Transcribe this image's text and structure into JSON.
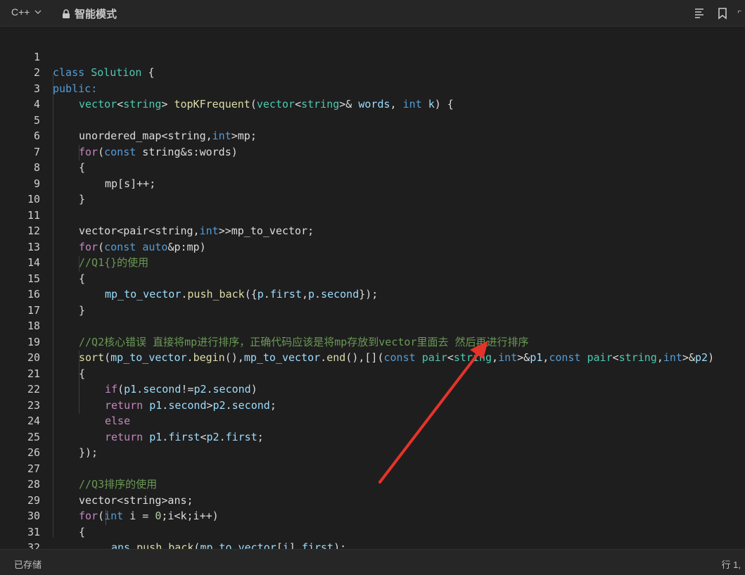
{
  "toolbar": {
    "language": "C++",
    "mode": "智能模式",
    "icons": [
      "align-left-icon",
      "bookmark-icon",
      "expand-icon"
    ]
  },
  "status": {
    "saved": "已存储",
    "cursor": "行 1,"
  },
  "colors": {
    "keyword": "#569cd6",
    "type": "#4ec9b0",
    "function": "#dcdcaa",
    "comment": "#6a9955",
    "annotation_arrow": "#e5332a"
  },
  "lines": [
    {
      "n": "1"
    },
    {
      "n": "2"
    },
    {
      "n": "3"
    },
    {
      "n": "4"
    },
    {
      "n": "5"
    },
    {
      "n": "6"
    },
    {
      "n": "7"
    },
    {
      "n": "8"
    },
    {
      "n": "9"
    },
    {
      "n": "10"
    },
    {
      "n": "11"
    },
    {
      "n": "12"
    },
    {
      "n": "13"
    },
    {
      "n": "14"
    },
    {
      "n": "15"
    },
    {
      "n": "16"
    },
    {
      "n": "17"
    },
    {
      "n": "18"
    },
    {
      "n": "19"
    },
    {
      "n": "20"
    },
    {
      "n": "21"
    },
    {
      "n": "22"
    },
    {
      "n": "23"
    },
    {
      "n": "24"
    },
    {
      "n": "25"
    },
    {
      "n": "26"
    },
    {
      "n": "27"
    },
    {
      "n": "28"
    },
    {
      "n": "29"
    },
    {
      "n": "30"
    },
    {
      "n": "31"
    },
    {
      "n": "32"
    }
  ],
  "code": {
    "l1": [
      "class",
      " ",
      "Solution",
      " {"
    ],
    "l2": [
      "public",
      ":"
    ],
    "l3": [
      "vector",
      "<",
      "string",
      "> ",
      "topKFrequent",
      "(",
      "vector",
      "<",
      "string",
      ">& ",
      "words",
      ", ",
      "int",
      " ",
      "k",
      ") {"
    ],
    "l5": [
      "unordered_map<string,",
      "int",
      ">mp;"
    ],
    "l6": [
      "for",
      "(",
      "const",
      " string&s:words)"
    ],
    "l7": [
      "{"
    ],
    "l8": [
      "mp[s]++;"
    ],
    "l9": [
      "}"
    ],
    "l11": [
      "vector<pair<string,",
      "int",
      ">>mp_to_vector;"
    ],
    "l12": [
      "for",
      "(",
      "const",
      " ",
      "auto",
      "&p:mp)"
    ],
    "l13": [
      "//Q1{}的使用"
    ],
    "l14": [
      "{"
    ],
    "l15": [
      "mp_to_vector",
      ".",
      "push_back",
      "({",
      "p",
      ".",
      "first",
      ",",
      "p",
      ".",
      "second",
      "});"
    ],
    "l16": [
      "}"
    ],
    "l18": [
      "//Q2核心错误 直接将mp进行排序，正确代码应该是将mp存放到vector里面去 然后再进行排序"
    ],
    "l19": [
      "sort",
      "(",
      "mp_to_vector",
      ".",
      "begin",
      "(),",
      "mp_to_vector",
      ".",
      "end",
      "(),[](",
      "const",
      " ",
      "pair",
      "<",
      "string",
      ",",
      "int",
      ">&",
      "p1",
      ",",
      "const",
      " ",
      "pair",
      "<",
      "string",
      ",",
      "int",
      ">&",
      "p2",
      ")"
    ],
    "l20": [
      "{"
    ],
    "l21": [
      "if",
      "(",
      "p1",
      ".",
      "second",
      "!=",
      "p2",
      ".",
      "second",
      ")"
    ],
    "l22": [
      "return",
      " ",
      "p1",
      ".",
      "second",
      ">",
      "p2",
      ".",
      "second",
      ";"
    ],
    "l23": [
      "else"
    ],
    "l24": [
      "return",
      " ",
      "p1",
      ".",
      "first",
      "<",
      "p2",
      ".",
      "first",
      ";"
    ],
    "l25": [
      "});"
    ],
    "l27": [
      "//Q3排序的使用"
    ],
    "l28": [
      "vector<string>ans;"
    ],
    "l29": [
      "for",
      "(",
      "int",
      " i = ",
      "0",
      ";i<k;i++)"
    ],
    "l30": [
      "{"
    ],
    "l31": [
      "ans",
      ".",
      "push_back",
      "(",
      "mp_to_vector",
      "[",
      "i",
      "].",
      "first",
      ");"
    ],
    "l32": [
      "}"
    ]
  }
}
